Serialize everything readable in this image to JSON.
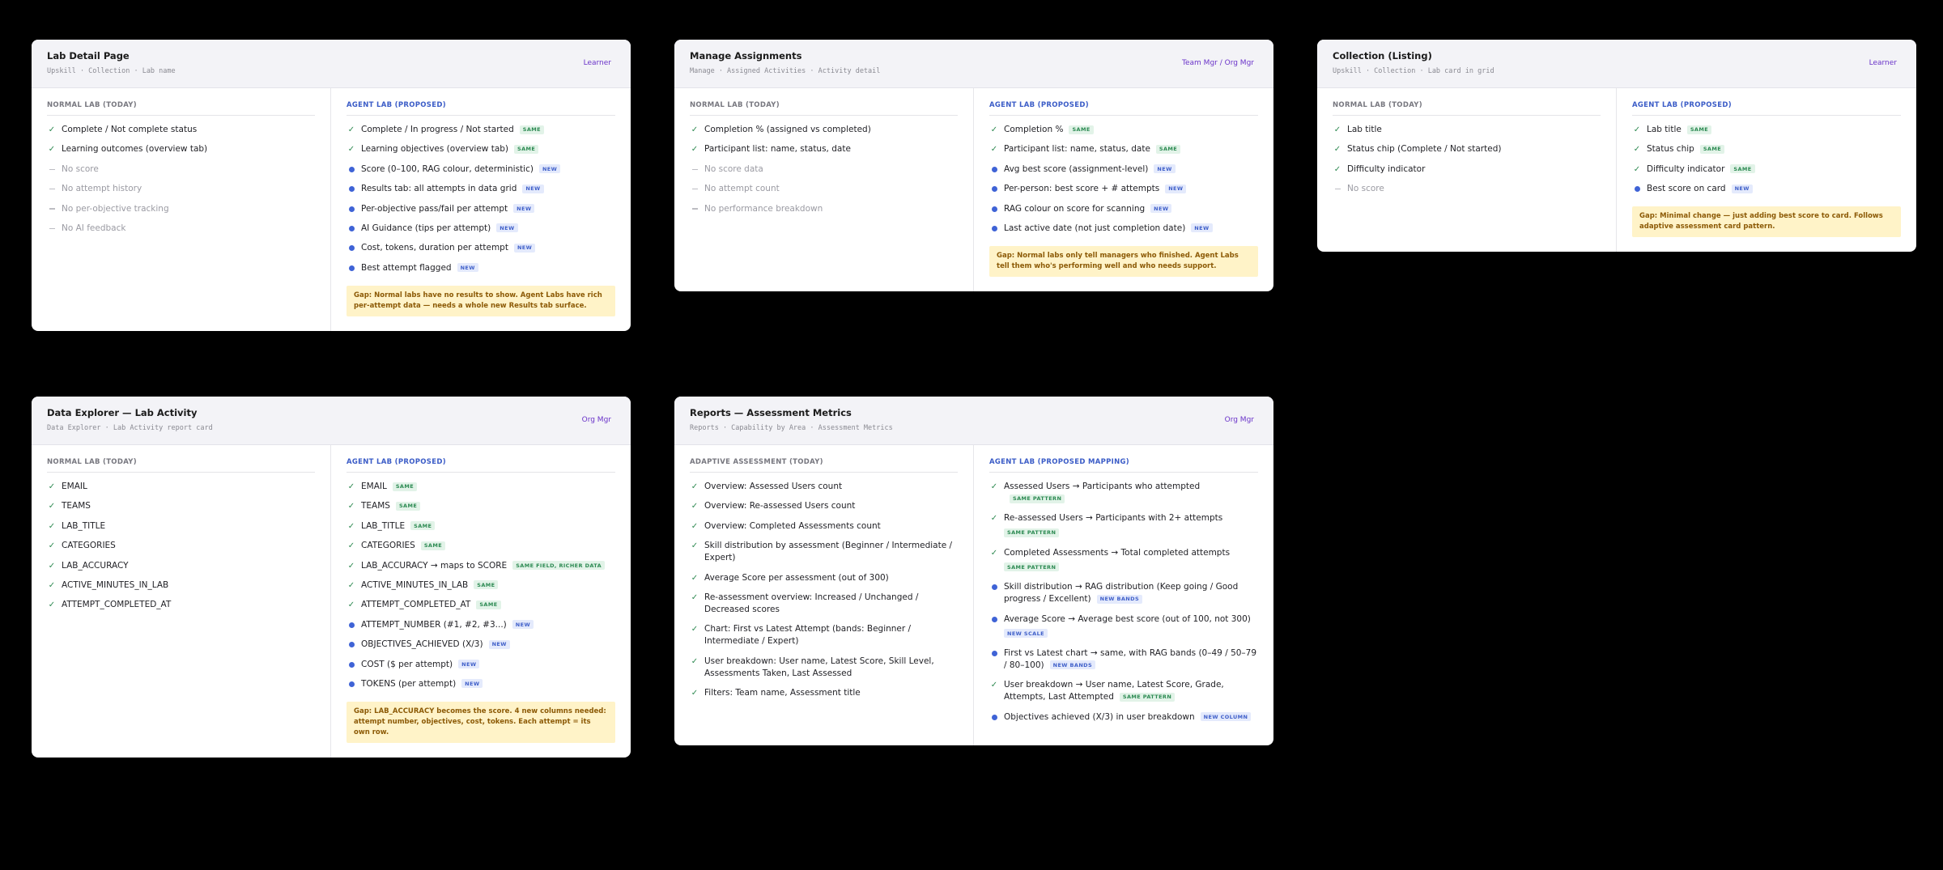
{
  "cards": [
    {
      "title": "Lab Detail Page",
      "crumb": "Upskill · Collection · Lab name",
      "role": "Learner",
      "left": {
        "heading": "NORMAL LAB (TODAY)",
        "items": [
          {
            "text": "Complete / Not complete status"
          },
          {
            "text": "Learning outcomes (overview tab)"
          },
          {
            "text": "No score"
          },
          {
            "text": "No attempt history"
          },
          {
            "text": "No per-objective tracking"
          },
          {
            "text": "No AI feedback"
          }
        ]
      },
      "right": {
        "heading": "AGENT LAB (PROPOSED)",
        "items": [
          {
            "text": "Complete / In progress / Not started",
            "badge": "SAME"
          },
          {
            "text": "Learning objectives (overview tab)",
            "badge": "SAME"
          },
          {
            "text": "Score (0–100, RAG colour, deterministic)",
            "badge": "NEW"
          },
          {
            "text": "Results tab: all attempts in data grid",
            "badge": "NEW"
          },
          {
            "text": "Per-objective pass/fail per attempt",
            "badge": "NEW"
          },
          {
            "text": "AI Guidance (tips per attempt)",
            "badge": "NEW"
          },
          {
            "text": "Cost, tokens, duration per attempt",
            "badge": "NEW"
          },
          {
            "text": "Best attempt flagged",
            "badge": "NEW"
          }
        ],
        "gap": "Gap: Normal labs have no results to show. Agent Labs have rich per-attempt data — needs a whole new Results tab surface."
      }
    },
    {
      "title": "Manage Assignments",
      "crumb": "Manage · Assigned Activities · Activity detail",
      "role": "Team Mgr / Org Mgr",
      "left": {
        "heading": "NORMAL LAB (TODAY)",
        "items": [
          {
            "text": "Completion % (assigned vs completed)"
          },
          {
            "text": "Participant list: name, status, date"
          },
          {
            "text": "No score data"
          },
          {
            "text": "No attempt count"
          },
          {
            "text": "No performance breakdown"
          }
        ]
      },
      "right": {
        "heading": "AGENT LAB (PROPOSED)",
        "items": [
          {
            "text": "Completion %",
            "badge": "SAME"
          },
          {
            "text": "Participant list: name, status, date",
            "badge": "SAME"
          },
          {
            "text": "Avg best score (assignment-level)",
            "badge": "NEW"
          },
          {
            "text": "Per-person: best score + # attempts",
            "badge": "NEW"
          },
          {
            "text": "RAG colour on score for scanning",
            "badge": "NEW"
          },
          {
            "text": "Last active date (not just completion date)",
            "badge": "NEW"
          }
        ],
        "gap": "Gap: Normal labs only tell managers who finished. Agent Labs tell them who's performing well and who needs support."
      }
    },
    {
      "title": "Collection (Listing)",
      "crumb": "Upskill · Collection · Lab card in grid",
      "role": "Learner",
      "left": {
        "heading": "NORMAL LAB (TODAY)",
        "items": [
          {
            "text": "Lab title"
          },
          {
            "text": "Status chip (Complete / Not started)"
          },
          {
            "text": "Difficulty indicator"
          },
          {
            "text": "No score"
          }
        ]
      },
      "right": {
        "heading": "AGENT LAB (PROPOSED)",
        "items": [
          {
            "text": "Lab title",
            "badge": "SAME"
          },
          {
            "text": "Status chip",
            "badge": "SAME"
          },
          {
            "text": "Difficulty indicator",
            "badge": "SAME"
          },
          {
            "text": "Best score on card",
            "badge": "NEW"
          }
        ],
        "gap": "Gap: Minimal change — just adding best score to card. Follows adaptive assessment card pattern."
      }
    },
    {
      "title": "Data Explorer — Lab Activity",
      "crumb": "Data Explorer · Lab Activity report card",
      "role": "Org Mgr",
      "left": {
        "heading": "NORMAL LAB (TODAY)",
        "items": [
          {
            "text": "EMAIL"
          },
          {
            "text": "TEAMS"
          },
          {
            "text": "LAB_TITLE"
          },
          {
            "text": "CATEGORIES"
          },
          {
            "text": "LAB_ACCURACY"
          },
          {
            "text": "ACTIVE_MINUTES_IN_LAB"
          },
          {
            "text": "ATTEMPT_COMPLETED_AT"
          }
        ]
      },
      "right": {
        "heading": "AGENT LAB (PROPOSED)",
        "items": [
          {
            "text": "EMAIL",
            "badge": "SAME"
          },
          {
            "text": "TEAMS",
            "badge": "SAME"
          },
          {
            "text": "LAB_TITLE",
            "badge": "SAME"
          },
          {
            "text": "CATEGORIES",
            "badge": "SAME"
          },
          {
            "text": "LAB_ACCURACY → maps to SCORE",
            "badge": "SAME FIELD, RICHER DATA"
          },
          {
            "text": "ACTIVE_MINUTES_IN_LAB",
            "badge": "SAME"
          },
          {
            "text": "ATTEMPT_COMPLETED_AT",
            "badge": "SAME"
          },
          {
            "text": "ATTEMPT_NUMBER (#1, #2, #3...)",
            "badge": "NEW"
          },
          {
            "text": "OBJECTIVES_ACHIEVED (X/3)",
            "badge": "NEW"
          },
          {
            "text": "COST ($ per attempt)",
            "badge": "NEW"
          },
          {
            "text": "TOKENS (per attempt)",
            "badge": "NEW"
          }
        ],
        "gap": "Gap: LAB_ACCURACY becomes the score. 4 new columns needed: attempt number, objectives, cost, tokens. Each attempt = its own row."
      }
    },
    {
      "title": "Reports — Assessment Metrics",
      "crumb": "Reports · Capability by Area · Assessment Metrics",
      "role": "Org Mgr",
      "left": {
        "heading": "ADAPTIVE ASSESSMENT (TODAY)",
        "items": [
          {
            "text": "Overview: Assessed Users count"
          },
          {
            "text": "Overview: Re-assessed Users count"
          },
          {
            "text": "Overview: Completed Assessments count"
          },
          {
            "text": "Skill distribution by assessment (Beginner / Intermediate / Expert)"
          },
          {
            "text": "Average Score per assessment (out of 300)"
          },
          {
            "text": "Re-assessment overview: Increased / Unchanged / Decreased scores"
          },
          {
            "text": "Chart: First vs Latest Attempt (bands: Beginner / Intermediate / Expert)"
          },
          {
            "text": "User breakdown: User name, Latest Score, Skill Level, Assessments Taken, Last Assessed"
          },
          {
            "text": "Filters: Team name, Assessment title"
          }
        ]
      },
      "right": {
        "heading": "AGENT LAB (PROPOSED MAPPING)",
        "items": [
          {
            "text": "Assessed Users → Participants who attempted",
            "badge": "SAME PATTERN"
          },
          {
            "text": "Re-assessed Users → Participants with 2+ attempts",
            "badge": "SAME PATTERN",
            "badge_newline": true
          },
          {
            "text": "Completed Assessments → Total completed attempts",
            "badge": "SAME PATTERN",
            "badge_newline": true
          },
          {
            "text": "Skill distribution → RAG distribution (Keep going / Good progress / Excellent)",
            "badge": "NEW BANDS"
          },
          {
            "text": "Average Score → Average best score (out of 100, not 300)",
            "badge": "NEW SCALE",
            "badge_newline": true
          },
          {
            "text": "First vs Latest chart → same, with RAG bands (0–49 / 50–79 / 80–100)",
            "badge": "NEW BANDS"
          },
          {
            "text": "User breakdown → User name, Latest Score, Grade, Attempts, Last Attempted",
            "badge": "SAME PATTERN"
          },
          {
            "text": "Objectives achieved (X/3) in user breakdown",
            "badge": "NEW COLUMN"
          }
        ]
      }
    }
  ]
}
